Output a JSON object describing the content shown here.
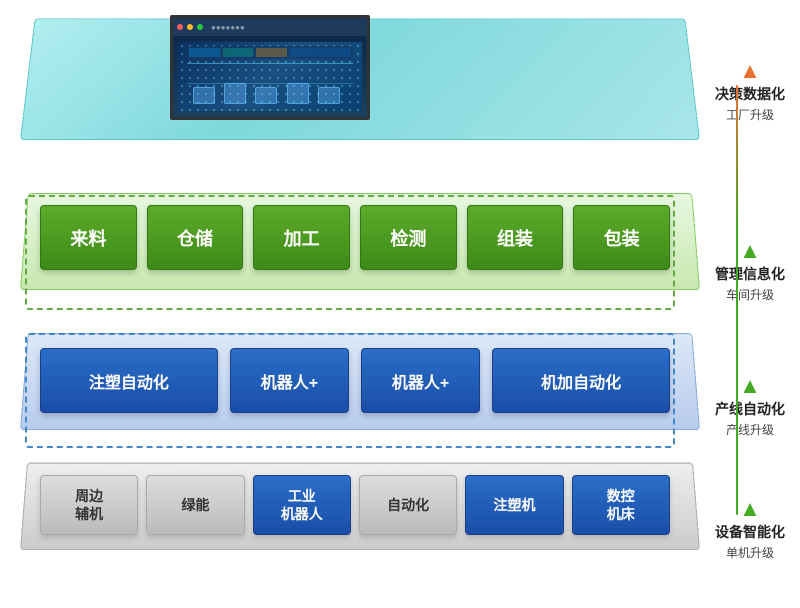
{
  "layers": {
    "decision": {
      "label_main": "决策数据化",
      "label_sub": "工厂升级"
    },
    "management": {
      "label_main": "管理信息化",
      "label_sub": "车间升级",
      "boxes": [
        "来料",
        "仓储",
        "加工",
        "检测",
        "组装",
        "包装"
      ]
    },
    "production": {
      "label_main": "产线自动化",
      "label_sub": "产线升级",
      "boxes": [
        {
          "label": "注塑自动化",
          "type": "wide"
        },
        {
          "label": "机器人+",
          "type": "normal"
        },
        {
          "label": "机器人+",
          "type": "normal"
        },
        {
          "label": "机加自动化",
          "type": "wide"
        }
      ]
    },
    "equipment": {
      "label_main": "设备智能化",
      "label_sub": "单机升级",
      "boxes": [
        {
          "label": "周边\n辅机",
          "type": "gray"
        },
        {
          "label": "绿能",
          "type": "gray"
        },
        {
          "label": "工业\n机器人",
          "type": "blue"
        },
        {
          "label": "自动化",
          "type": "gray"
        },
        {
          "label": "注塑机",
          "type": "blue"
        },
        {
          "label": "数控\n机床",
          "type": "blue"
        }
      ]
    }
  }
}
